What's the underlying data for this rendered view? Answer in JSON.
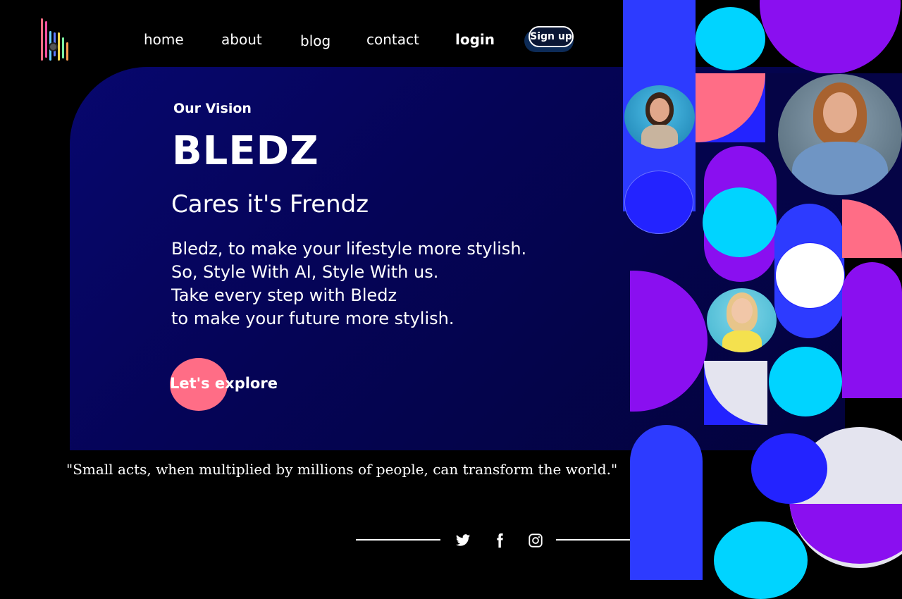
{
  "nav": {
    "items": [
      "home",
      "about",
      "blog",
      "contact"
    ],
    "login_label": "login",
    "signup_label": "Sign up"
  },
  "hero": {
    "eyebrow": "Our Vision",
    "brand": "BLEDZ",
    "tagline": "Cares it's Frendz",
    "description_lines": [
      "Bledz, to make your lifestyle more stylish.",
      "So, Style With AI, Style With us.",
      "Take every step with Bledz",
      "to make your future more stylish."
    ],
    "cta_label": "Let's explore"
  },
  "quote": "\"Small acts, when multiplied by millions of people, can transform the world.\"",
  "social": {
    "icons": [
      "twitter-icon",
      "facebook-icon",
      "instagram-icon"
    ]
  },
  "colors": {
    "background": "#000000",
    "hero_panel": "#06056a",
    "accent_pink": "#ff6d86",
    "blue": "#2323ff",
    "cyan": "#00d4ff",
    "purple": "#8a0ff0",
    "pale": "#e4e4ef"
  }
}
